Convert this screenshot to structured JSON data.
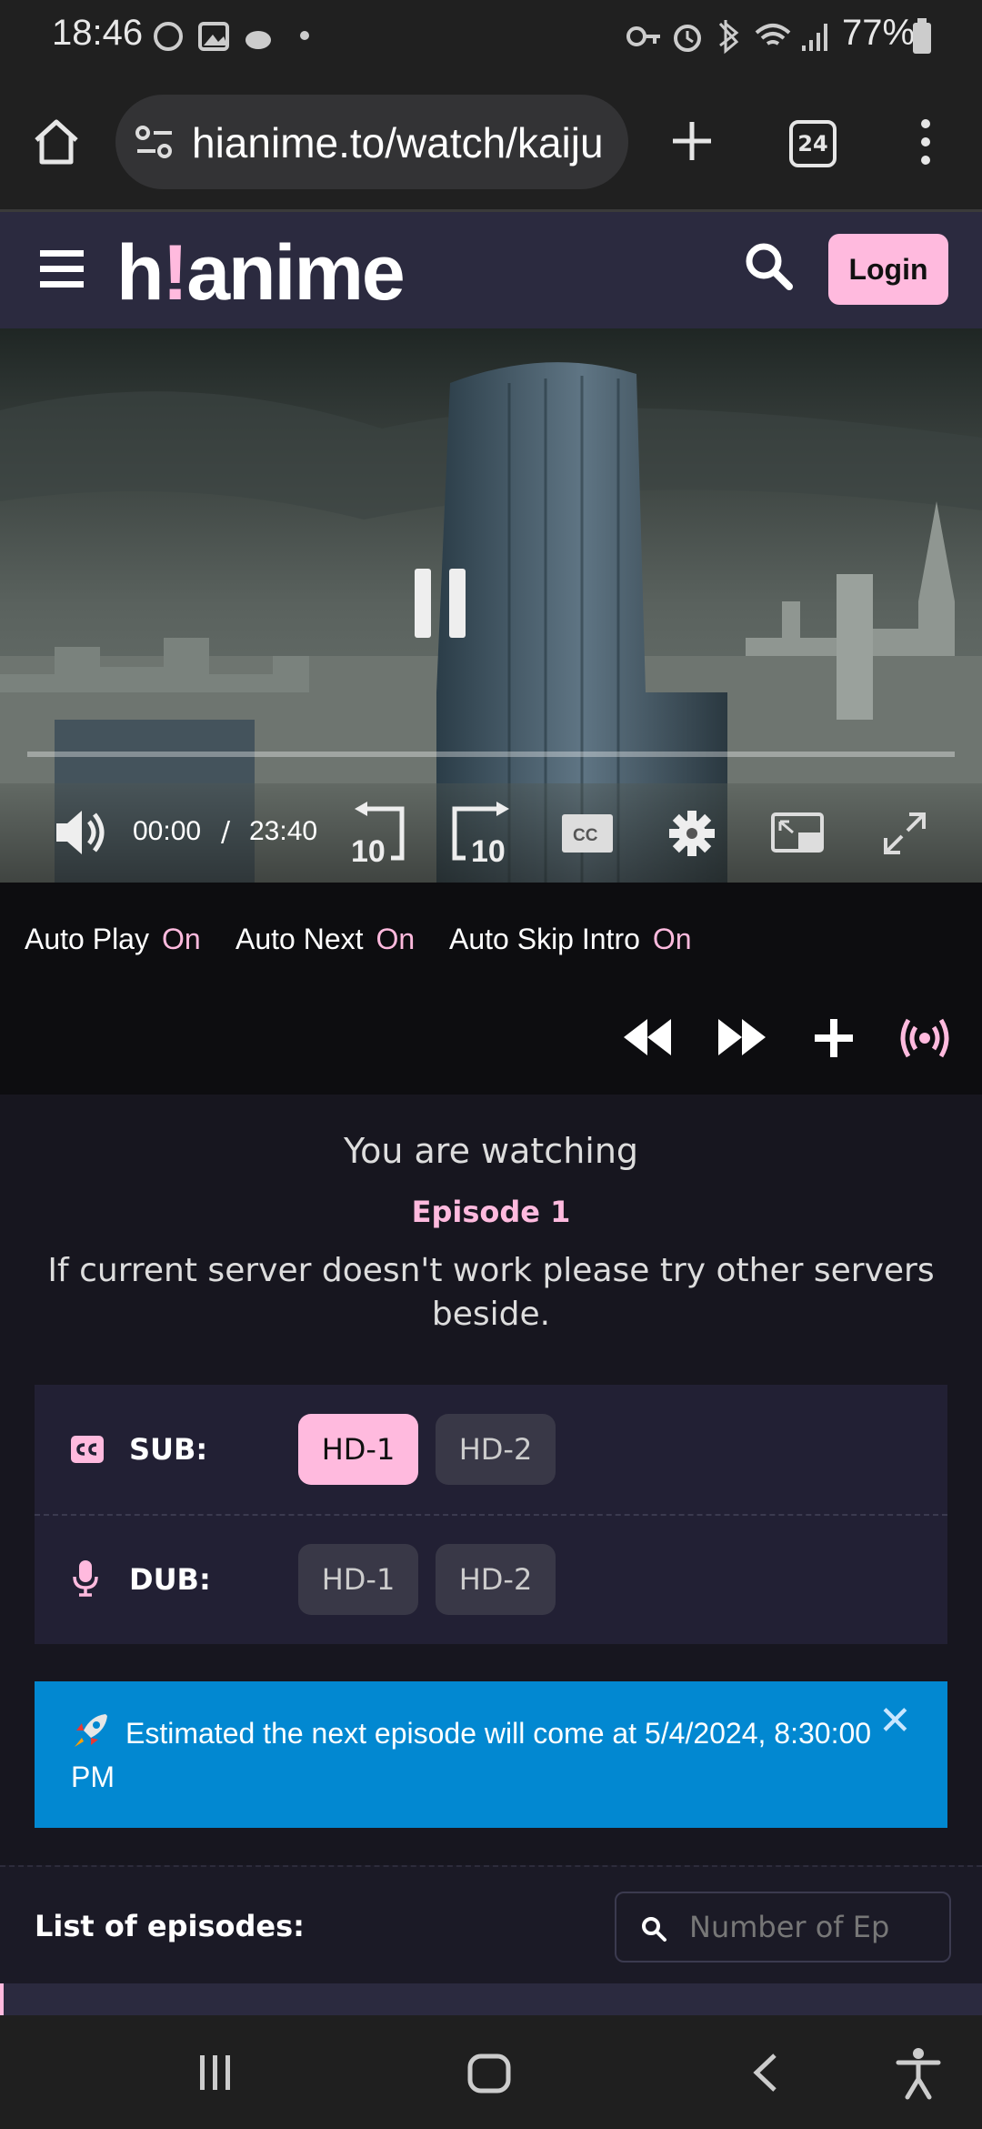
{
  "status_bar": {
    "time": "18:46",
    "battery": "77%"
  },
  "browser": {
    "url": "hianime.to/watch/kaiju",
    "tab_count": "24"
  },
  "site": {
    "logo_left": "h",
    "logo_bang": "!",
    "logo_right": "anime",
    "login_label": "Login",
    "accent_color": "#ffbade"
  },
  "player": {
    "current_time": "00:00",
    "separator": "/",
    "duration": "23:40",
    "progress": 0,
    "rewind_seconds": "10",
    "forward_seconds": "10",
    "cc_label": "CC"
  },
  "toggles": [
    {
      "label": "Auto Play",
      "state": "On"
    },
    {
      "label": "Auto Next",
      "state": "On"
    },
    {
      "label": "Auto Skip Intro",
      "state": "On"
    }
  ],
  "info": {
    "watching": "You are watching",
    "episode": "Episode 1",
    "note": "If current server doesn't work please try other servers beside."
  },
  "servers": {
    "sub": {
      "label": "SUB:",
      "buttons": [
        "HD-1",
        "HD-2"
      ],
      "active_index": 0
    },
    "dub": {
      "label": "DUB:",
      "buttons": [
        "HD-1",
        "HD-2"
      ]
    }
  },
  "banner": {
    "text": "Estimated the next episode will come at 5/4/2024, 8:30:00 PM",
    "close": "✕"
  },
  "episodes": {
    "label": "List of episodes:",
    "search_placeholder": "Number of Ep"
  }
}
